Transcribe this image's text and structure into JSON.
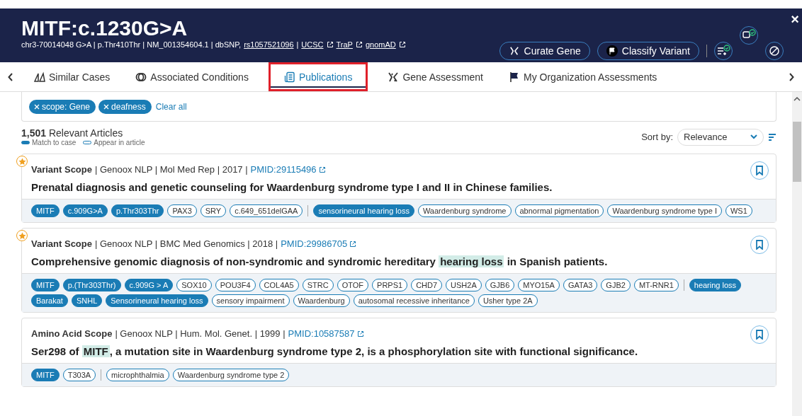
{
  "header": {
    "title": "MITF:c.1230G>A",
    "subtitle": "chr3-70014048 G>A | p.Thr410Thr | NM_001354604.1 | dbSNP,",
    "dbsnp_link": "rs1057521096",
    "separator": "|",
    "links": [
      "UCSC",
      "TraP",
      "gnomAD"
    ],
    "buttons": [
      "Curate Gene",
      "Classify Variant"
    ],
    "close": "×"
  },
  "tabs": [
    {
      "label": "Similar Cases",
      "selected": false
    },
    {
      "label": "Associated Conditions",
      "selected": false
    },
    {
      "label": "Publications",
      "selected": true
    },
    {
      "label": "Gene Assessment",
      "selected": false
    },
    {
      "label": "My Organization Assessments",
      "selected": false
    }
  ],
  "filters": {
    "chips": [
      "scope: Gene",
      "deafness"
    ],
    "clear": "Clear all"
  },
  "results": {
    "count": "1,501",
    "label": "Relevant Articles",
    "legend": [
      "Match to case",
      "Appear in article"
    ],
    "sort_label": "Sort by:",
    "sort_value": "Relevance"
  },
  "articles": [
    {
      "starred": true,
      "scope": "Variant Scope",
      "meta": "| Genoox NLP | Mol Med Rep | 2017 |",
      "pmid": "PMID:29115496",
      "bookmarked": false,
      "title": [
        {
          "text": "Prenatal diagnosis and genetic counseling for Waardenburg syndrome type I and II in Chinese families.",
          "highlighted": false
        }
      ],
      "tag_groups": [
        [
          {
            "label": "MITF",
            "match": true
          },
          {
            "label": "c.909G>A",
            "match": true
          },
          {
            "label": "p.Thr303Thr",
            "match": true
          },
          {
            "label": "PAX3",
            "match": false
          },
          {
            "label": "SRY",
            "match": false
          },
          {
            "label": "c.649_651delGAA",
            "match": false
          }
        ],
        [
          {
            "label": "sensorineural hearing loss",
            "match": true
          },
          {
            "label": "Waardenburg syndrome",
            "match": false
          },
          {
            "label": "abnormal pigmentation",
            "match": false
          },
          {
            "label": "Waardenburg syndrome type I",
            "match": false
          },
          {
            "label": "WS1",
            "match": false
          }
        ]
      ]
    },
    {
      "starred": true,
      "scope": "Variant Scope",
      "meta": "| Genoox NLP | BMC Med Genomics | 2018 |",
      "pmid": "PMID:29986705",
      "bookmarked": false,
      "title": [
        {
          "text": "Comprehensive genomic diagnosis of non-syndromic and syndromic hereditary",
          "highlighted": false
        },
        {
          "text": "hearing loss",
          "highlighted": true
        },
        {
          "text": "in Spanish patients.",
          "highlighted": false
        }
      ],
      "tag_groups": [
        [
          {
            "label": "MITF",
            "match": true
          },
          {
            "label": "p.(Thr303Thr)",
            "match": true
          },
          {
            "label": "c.909G > A",
            "match": true
          },
          {
            "label": "SOX10",
            "match": false
          },
          {
            "label": "POU3F4",
            "match": false
          },
          {
            "label": "COL4A5",
            "match": false
          },
          {
            "label": "STRC",
            "match": false
          },
          {
            "label": "OTOF",
            "match": false
          },
          {
            "label": "PRPS1",
            "match": false
          },
          {
            "label": "CHD7",
            "match": false
          },
          {
            "label": "USH2A",
            "match": false
          },
          {
            "label": "GJB6",
            "match": false
          },
          {
            "label": "MYO15A",
            "match": false
          },
          {
            "label": "GATA3",
            "match": false
          },
          {
            "label": "GJB2",
            "match": false
          },
          {
            "label": "MT-RNR1",
            "match": false
          }
        ],
        [
          {
            "label": "hearing loss",
            "match": true
          },
          {
            "label": "Barakat",
            "match": true
          },
          {
            "label": "SNHL",
            "match": true
          },
          {
            "label": "Sensorineural hearing loss",
            "match": true
          },
          {
            "label": "sensory impairment",
            "match": false
          },
          {
            "label": "Waardenburg",
            "match": false
          },
          {
            "label": "autosomal recessive inheritance",
            "match": false
          },
          {
            "label": "Usher type 2A",
            "match": false
          }
        ]
      ]
    },
    {
      "starred": false,
      "scope": "Amino Acid Scope",
      "meta": "| Genoox NLP | Hum. Mol. Genet. | 1999 |",
      "pmid": "PMID:10587587",
      "bookmarked": false,
      "title": [
        {
          "text": "Ser298 of",
          "highlighted": false
        },
        {
          "text": "MITF",
          "highlighted": true
        },
        {
          "text": ", a mutation site in Waardenburg syndrome type 2, is a phosphorylation site with functional significance.",
          "highlighted": false
        }
      ],
      "tag_groups": [
        [
          {
            "label": "MITF",
            "match": true
          },
          {
            "label": "T303A",
            "match": false
          }
        ],
        [
          {
            "label": "microphthalmia",
            "match": false
          },
          {
            "label": "Waardenburg syndrome type 2",
            "match": false
          }
        ]
      ]
    }
  ]
}
